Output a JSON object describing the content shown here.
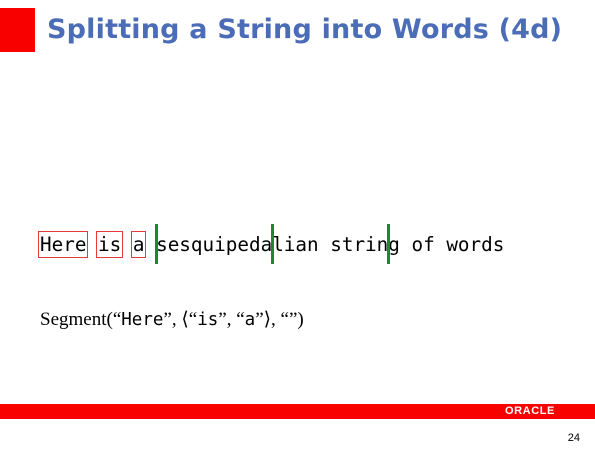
{
  "slide": {
    "title": "Splitting a String into Words (4d)",
    "sentence": {
      "boxed_words": [
        "Here",
        "is",
        "a"
      ],
      "seg1": "sesquipeda",
      "seg2": "lian strin",
      "seg3": "g of words"
    },
    "segment_expr": {
      "fn_open": "Segment(“",
      "arg1": "Here",
      "sep1": "”, ⟨“",
      "w1": "is",
      "sep2": "”, “",
      "w2": "a",
      "close": "”⟩, “”)"
    },
    "footer": {
      "logo": "ORACLE",
      "page_number": "24"
    },
    "colors": {
      "accent_red": "#f80000",
      "title_blue": "#4b6cb7",
      "box_red": "#e33b3b",
      "bar_green": "#1b8a2a"
    }
  }
}
